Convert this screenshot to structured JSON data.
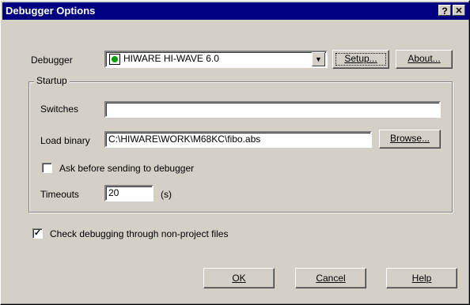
{
  "window": {
    "title": "Debugger Options",
    "help_glyph": "?",
    "close_glyph": "✕"
  },
  "debugger": {
    "label": "Debugger",
    "selected": "HIWARE HI-WAVE 6.0",
    "icon": "green-dot-icon",
    "setup_label": "Setup...",
    "about_label": "About..."
  },
  "startup": {
    "group_label": "Startup",
    "switches_label": "Switches",
    "switches_value": "",
    "load_binary_label": "Load binary",
    "load_binary_value": "C:\\HIWARE\\WORK\\M68KC\\fibo.abs",
    "browse_label": "Browse...",
    "ask_label": "Ask before sending to debugger",
    "ask_checked": false,
    "timeouts_label": "Timeouts",
    "timeouts_value": "20",
    "timeouts_unit": "(s)"
  },
  "check_nonproject": {
    "label": "Check debugging through non-project files",
    "checked": true
  },
  "footer": {
    "ok_label": "OK",
    "cancel_label": "Cancel",
    "help_label": "Help"
  }
}
